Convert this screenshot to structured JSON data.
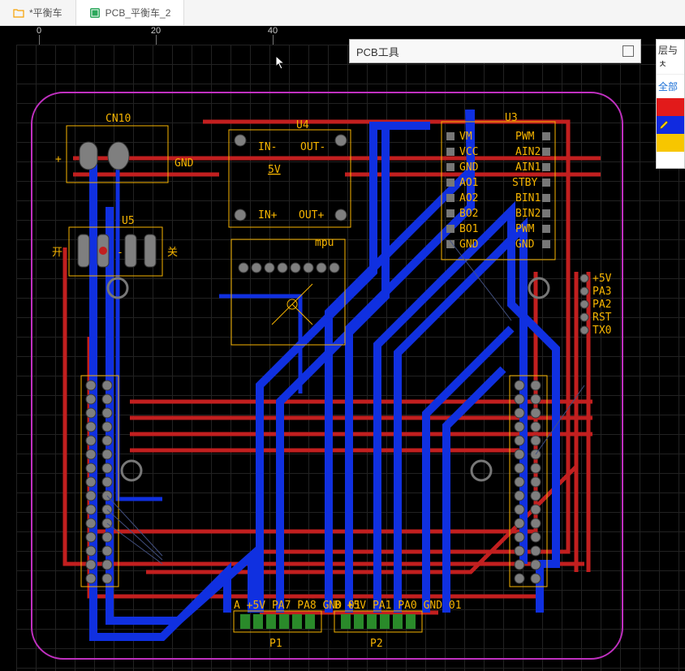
{
  "tabs": [
    {
      "label": "*平衡车",
      "icon": "folder",
      "active": false
    },
    {
      "label": "PCB_平衡车_2",
      "icon": "pcb",
      "active": true
    }
  ],
  "ruler": {
    "ticks": [
      "0",
      "20",
      "40"
    ]
  },
  "toolbar": {
    "title": "PCB工具"
  },
  "side_panel": {
    "header": "层与ㅊ",
    "all_label": "全部"
  },
  "components": {
    "CN10": "CN10",
    "GND1": "GND",
    "U4": "U4",
    "IN_minus": "IN-",
    "OUT_minus": "OUT-",
    "five_v": "5V",
    "IN_plus": "IN+",
    "OUT_plus": "OUT+",
    "U5": "U5",
    "open": "开",
    "close": "关",
    "plus": "+",
    "minus": "-",
    "mpu": "mpu",
    "U3": "U3",
    "left_pins": [
      "VM",
      "VCC",
      "GND",
      "AO1",
      "AO2",
      "BO2",
      "BO1",
      "GND"
    ],
    "right_pins": [
      "PWM",
      "AIN2",
      "AIN1",
      "STBY",
      "BIN1",
      "BIN2",
      "PWM",
      "GND"
    ],
    "side_lbls": [
      "+5V",
      "PA3",
      "PA2",
      "RST",
      "TX0"
    ],
    "P1": "P1",
    "P2": "P2",
    "p1_lbls": "A    +5V PA7 PA8 GND    01",
    "p2_lbls": "B    +5V PA1 PA0 GND    01"
  }
}
